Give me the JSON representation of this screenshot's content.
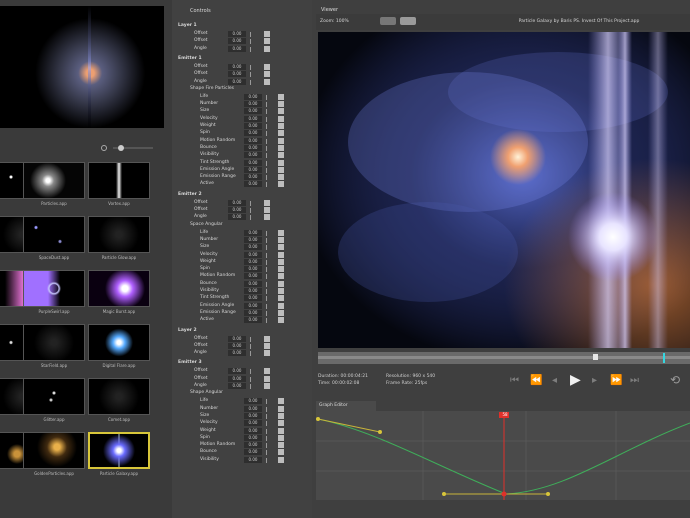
{
  "panels": {
    "properties_title": "Controls",
    "viewer_title": "Viewer",
    "graph_title": "Graph Editor"
  },
  "viewer": {
    "zoom": "Zoom: 100%",
    "title": "Particle Galaxy by Baris PS. Invest Of This Project.app",
    "duration": "Duration: 00:00:04:21",
    "time": "Time: 00:00:02:08",
    "resolution": "Resolution: 960 x 540",
    "frame_rate": "Frame Rate: 25fps",
    "playhead_marker": "58"
  },
  "library": {
    "items": [
      {
        "label": "",
        "kind": "stars"
      },
      {
        "label": "Particles.app",
        "kind": "burst"
      },
      {
        "label": "Vortex.app",
        "kind": "streak"
      },
      {
        "label": "",
        "kind": "dark"
      },
      {
        "label": "SpaceDust.app",
        "kind": "dust"
      },
      {
        "label": "Particle Glow.app",
        "kind": "dark"
      },
      {
        "label": "",
        "kind": "pink"
      },
      {
        "label": "PurpleSwirl.app",
        "kind": "swirl"
      },
      {
        "label": "Magic Burst.app",
        "kind": "magic"
      },
      {
        "label": "",
        "kind": "dots"
      },
      {
        "label": "StarField.app",
        "kind": "dark"
      },
      {
        "label": "Digital Flare.app",
        "kind": "flare"
      },
      {
        "label": "",
        "kind": "dark"
      },
      {
        "label": "Glitter.app",
        "kind": "glitter"
      },
      {
        "label": "Comet.app",
        "kind": "dark"
      },
      {
        "label": "",
        "kind": "gold"
      },
      {
        "label": "GoldenParticles.app",
        "kind": "gold2"
      },
      {
        "label": "Particle Galaxy.app",
        "kind": "galaxy"
      }
    ]
  },
  "properties": [
    {
      "type": "section",
      "label": "Layer 1"
    },
    {
      "type": "param",
      "label": "Offset",
      "value": "0.00"
    },
    {
      "type": "param",
      "label": "Offset",
      "value": "0.00"
    },
    {
      "type": "param",
      "label": "Angle",
      "value": "0.00"
    },
    {
      "type": "section",
      "label": "Emitter 1"
    },
    {
      "type": "param",
      "label": "Offset",
      "value": "0.00"
    },
    {
      "type": "param",
      "label": "Offset",
      "value": "0.00"
    },
    {
      "type": "param",
      "label": "Angle",
      "value": "0.00"
    },
    {
      "type": "group",
      "label": "Shape Fire Particles"
    },
    {
      "type": "param2",
      "label": "Life",
      "value": "0.00"
    },
    {
      "type": "param2",
      "label": "Number",
      "value": "0.00"
    },
    {
      "type": "param2",
      "label": "Size",
      "value": "0.00"
    },
    {
      "type": "param2",
      "label": "Velocity",
      "value": "0.00"
    },
    {
      "type": "param2",
      "label": "Weight",
      "value": "0.00"
    },
    {
      "type": "param2",
      "label": "Spin",
      "value": "0.00"
    },
    {
      "type": "param2",
      "label": "Motion Random",
      "value": "0.00"
    },
    {
      "type": "param2",
      "label": "Bounce",
      "value": "0.00"
    },
    {
      "type": "param2",
      "label": "Visibility",
      "value": "0.00"
    },
    {
      "type": "param2",
      "label": "Tint Strength",
      "value": "0.00"
    },
    {
      "type": "param2",
      "label": "Emission Angle",
      "value": "0.00"
    },
    {
      "type": "param2",
      "label": "Emission Range",
      "value": "0.00"
    },
    {
      "type": "param2",
      "label": "Active",
      "value": "0.00"
    },
    {
      "type": "section",
      "label": "Emitter 2"
    },
    {
      "type": "param",
      "label": "Offset",
      "value": "0.00"
    },
    {
      "type": "param",
      "label": "Offset",
      "value": "0.00"
    },
    {
      "type": "param",
      "label": "Angle",
      "value": "0.00"
    },
    {
      "type": "group",
      "label": "Space Angular"
    },
    {
      "type": "param2",
      "label": "Life",
      "value": "0.00"
    },
    {
      "type": "param2",
      "label": "Number",
      "value": "0.00"
    },
    {
      "type": "param2",
      "label": "Size",
      "value": "0.00"
    },
    {
      "type": "param2",
      "label": "Velocity",
      "value": "0.00"
    },
    {
      "type": "param2",
      "label": "Weight",
      "value": "0.00"
    },
    {
      "type": "param2",
      "label": "Spin",
      "value": "0.00"
    },
    {
      "type": "param2",
      "label": "Motion Random",
      "value": "0.00"
    },
    {
      "type": "param2",
      "label": "Bounce",
      "value": "0.00"
    },
    {
      "type": "param2",
      "label": "Visibility",
      "value": "0.00"
    },
    {
      "type": "param2",
      "label": "Tint Strength",
      "value": "0.00"
    },
    {
      "type": "param2",
      "label": "Emission Angle",
      "value": "0.00"
    },
    {
      "type": "param2",
      "label": "Emission Range",
      "value": "0.00"
    },
    {
      "type": "param2",
      "label": "Active",
      "value": "0.00"
    },
    {
      "type": "section",
      "label": "Layer 2"
    },
    {
      "type": "param",
      "label": "Offset",
      "value": "0.00"
    },
    {
      "type": "param",
      "label": "Offset",
      "value": "0.00"
    },
    {
      "type": "param",
      "label": "Angle",
      "value": "0.00"
    },
    {
      "type": "section",
      "label": "Emitter 3"
    },
    {
      "type": "param",
      "label": "Offset",
      "value": "0.00"
    },
    {
      "type": "param",
      "label": "Offset",
      "value": "0.00"
    },
    {
      "type": "param",
      "label": "Angle",
      "value": "0.00"
    },
    {
      "type": "group",
      "label": "Shape Angular"
    },
    {
      "type": "param2",
      "label": "Life",
      "value": "0.00"
    },
    {
      "type": "param2",
      "label": "Number",
      "value": "0.00"
    },
    {
      "type": "param2",
      "label": "Size",
      "value": "0.00"
    },
    {
      "type": "param2",
      "label": "Velocity",
      "value": "0.00"
    },
    {
      "type": "param2",
      "label": "Weight",
      "value": "0.00"
    },
    {
      "type": "param2",
      "label": "Spin",
      "value": "0.00"
    },
    {
      "type": "param2",
      "label": "Motion Random",
      "value": "0.00"
    },
    {
      "type": "param2",
      "label": "Bounce",
      "value": "0.00"
    },
    {
      "type": "param2",
      "label": "Visibility",
      "value": "0.00"
    }
  ],
  "transport_icons": [
    "go-start-icon",
    "step-back-icon",
    "prev-frame-icon",
    "play-icon",
    "next-frame-icon",
    "step-forward-icon",
    "go-end-icon",
    "loop-icon"
  ],
  "colors": {
    "accent_yellow": "#d8c63a",
    "keyframe_red": "#e0302a",
    "curve_green": "#3fae5a",
    "curve_yellow": "#c8b43a",
    "playhead_cyan": "#35d6e0"
  },
  "graph": {
    "playhead_fraction": 0.5
  }
}
